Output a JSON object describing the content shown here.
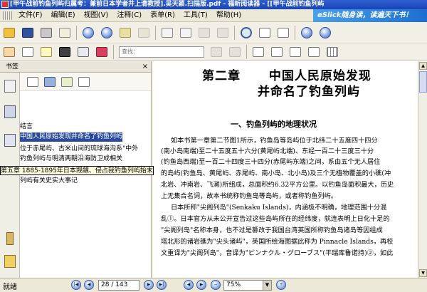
{
  "window": {
    "title": "[甲午战前钓鱼列屿归属考：兼前日本学者井上清教授].吴天颖.扫描版.pdf - 福昕阅读器 - [[甲午战前钓鱼列屿"
  },
  "menubar": {
    "items": [
      "文件(F)",
      "编辑(E)",
      "视图(V)",
      "注释(C)",
      "表单(R)",
      "工具(T)",
      "帮助(H)"
    ],
    "promo_text": "eSlick随身读，读遍天下书！"
  },
  "toolbar": {
    "find_placeholder": "查找："
  },
  "bookmarks": {
    "header": "书签",
    "items": [
      {
        "label": "结言",
        "state": "normal"
      },
      {
        "label": "中国人民原始发现并命名了钓鱼列屿",
        "state": "selected"
      },
      {
        "label": "位于赤尾屿、古米山间的琉球海沟系\"中外",
        "state": "normal"
      },
      {
        "label": "钓鱼列屿与明清两朝沿海防卫成相关",
        "state": "normal"
      },
      {
        "label": "第五章 1885-1895年日本觊觎、侵占我钓鱼列屿始末",
        "state": "tooltip"
      },
      {
        "label": "列屿有关史实大事记",
        "state": "normal"
      }
    ]
  },
  "document": {
    "chapter": "第二章",
    "title_line1": "中国人民原始发现",
    "title_line2": "并命名了钓鱼列屿",
    "section": "一、钓鱼列屿的地理状况",
    "paragraphs": [
      "如本书第一章第二节图1所示，钓鱼岛等岛屿位于北纬二十五度四十四分",
      "(南小岛南端)至二十五度五十六分(黄尾屿北端)、东经一百二十三度三十分",
      "(钓鱼岛西端)至一百二十四度三十四分(赤尾屿东端)之间，系由五个无人居住",
      "的岛屿(钓鱼岛、黄尾屿、赤尾屿、南小岛、北小岛)及三个无植物覆盖的小礁(冲",
      "北岩、冲南岩、飞濑)所组成，总面积约6.32平方公里。以钓鱼岛面积最大，历史",
      "上无集合名词，故本书统称钓鱼岛等岛屿，或者称钓鱼列屿。",
      "日本所称\"尖阁列岛\"(Senkaku Islands)，内涵极不明确，地理范围十分混",
      "乱①。日本官方从未公开宣告过这些岛屿所在的经纬度，就连表明上日化十足的",
      "\"尖阁列岛\"名称本身，也不过是篡改于我国台湾英国所称钓鱼岛诸岛等因组成",
      "塔北形的诸岩礁为\"尖头诸屿\"，英国所绘海图据此称为 Pinnacle Islands，再校",
      "文重译为\"尖阁列岛\"，音译为\"ピンナクル・グローブス\"(平瑞库鲁诺持)②，如此"
    ]
  },
  "status": {
    "text": "就绪",
    "page": "28 / 143",
    "zoom": "75%"
  }
}
